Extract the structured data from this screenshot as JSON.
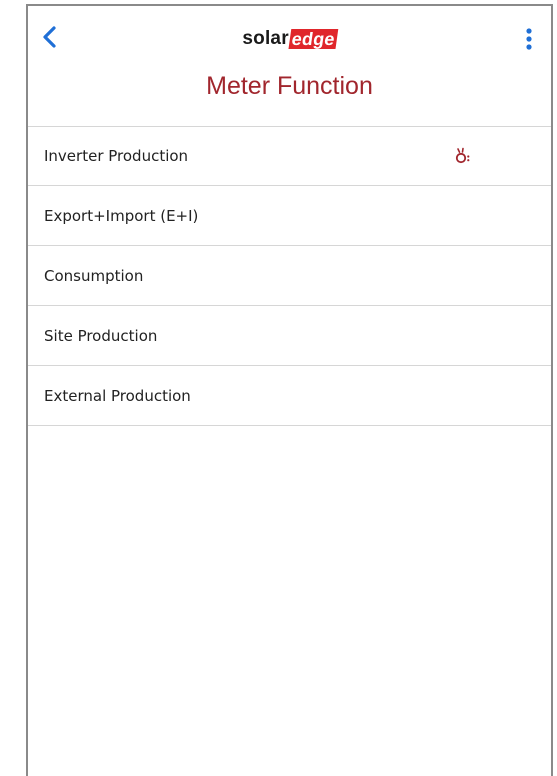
{
  "header": {
    "back_icon": "chevron-left-icon",
    "logo_part1": "solar",
    "logo_part2": "edge",
    "menu_icon": "kebab-menu-icon",
    "title": "Meter Function"
  },
  "list": {
    "items": [
      {
        "label": "Inverter Production",
        "selected": true,
        "icon": "sun-indicator-icon"
      },
      {
        "label": "Export+Import (E+I)"
      },
      {
        "label": "Consumption"
      },
      {
        "label": "Site Production"
      },
      {
        "label": "External Production"
      }
    ]
  },
  "colors": {
    "accent_red": "#a1262d",
    "logo_red": "#e0262b",
    "blue": "#1f6fd6",
    "divider": "#d6d6d6"
  }
}
